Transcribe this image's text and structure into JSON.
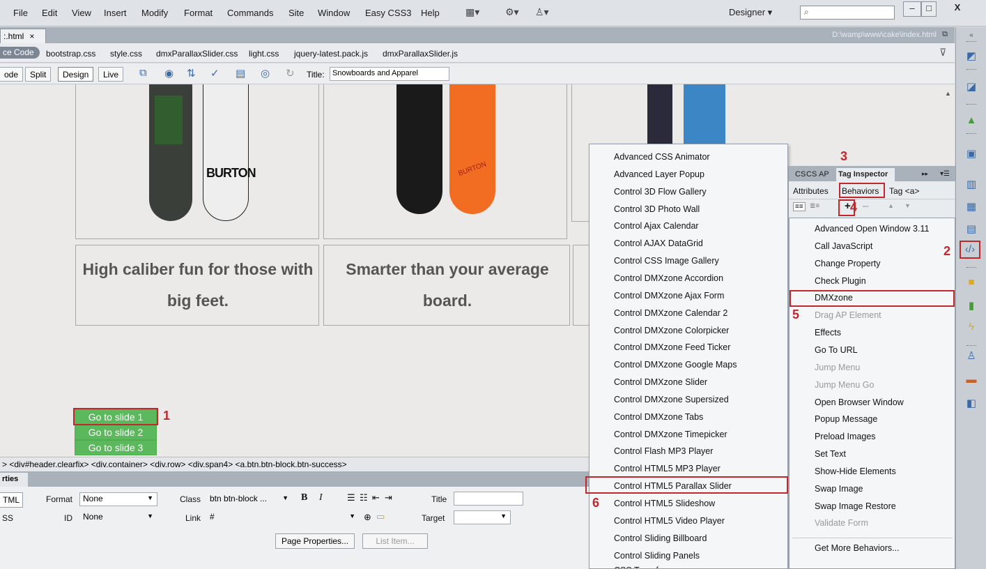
{
  "menubar": {
    "items": [
      "File",
      "Edit",
      "View",
      "Insert",
      "Modify",
      "Format",
      "Commands",
      "Site",
      "Window",
      "Easy CSS3",
      "Help"
    ],
    "workspace": "Designer",
    "workspace_arrow": "▾",
    "window_buttons": [
      "–",
      "□",
      "X"
    ]
  },
  "document": {
    "tab_label": ":.html",
    "tab_close": "×",
    "path": "D:\\wamp\\www\\cake\\index.html",
    "related_files": [
      "ce Code",
      "bootstrap.css",
      "style.css",
      "dmxParallaxSlider.css",
      "light.css",
      "jquery-latest.pack.js",
      "dmxParallaxSlider.js"
    ],
    "view_buttons": [
      "ode",
      "Split",
      "Design",
      "Live"
    ],
    "title_label": "Title:",
    "title_value": "Snowboards and Apparel"
  },
  "canvas": {
    "tagline_1": "High caliber fun for those with big feet.",
    "tagline_2": "Smarter than your average board.",
    "slide_buttons": [
      "Go to slide 1",
      "Go to slide 2",
      "Go to slide 3"
    ],
    "board_text_1": "BURTON",
    "board_text_2": "BURTON"
  },
  "tag_selector": "> <div#header.clearfix> <div.container> <div.row> <div.span4> <a.btn.btn-block.btn-success>",
  "properties": {
    "tab_label": "rties",
    "html_btn": "TML",
    "css_btn": "SS",
    "format_label": "Format",
    "format_value": "None",
    "id_label": "ID",
    "id_value": "None",
    "class_label": "Class",
    "class_value": "btn btn-block ...",
    "link_label": "Link",
    "link_value": "#",
    "title_label": "Title",
    "target_label": "Target",
    "page_properties": "Page Properties...",
    "list_item": "List Item..."
  },
  "submenu": {
    "items": [
      "Advanced CSS Animator",
      "Advanced Layer Popup",
      "Control 3D Flow Gallery",
      "Control 3D Photo Wall",
      "Control Ajax Calendar",
      "Control AJAX DataGrid",
      "Control CSS Image Gallery",
      "Control DMXzone Accordion",
      "Control DMXzone Ajax Form",
      "Control DMXzone Calendar 2",
      "Control DMXzone Colorpicker",
      "Control DMXzone Feed Ticker",
      "Control DMXzone Google Maps",
      "Control DMXzone Slider",
      "Control DMXzone Supersized",
      "Control DMXzone Tabs",
      "Control DMXzone Timepicker",
      "Control Flash MP3 Player",
      "Control HTML5 MP3 Player",
      "Control HTML5 Parallax Slider",
      "Control HTML5 Slideshow",
      "Control HTML5 Video Player",
      "Control Sliding Billboard",
      "Control Sliding Panels"
    ],
    "highlighted": "Control HTML5 Parallax Slider"
  },
  "panel": {
    "tabs": [
      "CS",
      "CS",
      "AP",
      "Tag Inspector"
    ],
    "sub_tabs": [
      "Attributes",
      "Behaviors",
      "Tag <a>"
    ],
    "add_button": "+",
    "remove_button": "–",
    "actions": [
      {
        "label": "Advanced Open Window 3.11",
        "enabled": true
      },
      {
        "label": "Call JavaScript",
        "enabled": true
      },
      {
        "label": "Change Property",
        "enabled": true
      },
      {
        "label": "Check Plugin",
        "enabled": true
      },
      {
        "label": "DMXzone",
        "enabled": true
      },
      {
        "label": "Drag AP Element",
        "enabled": false
      },
      {
        "label": "Effects",
        "enabled": true
      },
      {
        "label": "Go To URL",
        "enabled": true
      },
      {
        "label": "Jump Menu",
        "enabled": false
      },
      {
        "label": "Jump Menu Go",
        "enabled": false
      },
      {
        "label": "Open Browser Window",
        "enabled": true
      },
      {
        "label": "Popup Message",
        "enabled": true
      },
      {
        "label": "Preload Images",
        "enabled": true
      },
      {
        "label": "Set Text",
        "enabled": true
      },
      {
        "label": "Show-Hide Elements",
        "enabled": true
      },
      {
        "label": "Swap Image",
        "enabled": true
      },
      {
        "label": "Swap Image Restore",
        "enabled": true
      },
      {
        "label": "Validate Form",
        "enabled": false
      },
      {
        "label": "Get More Behaviors...",
        "enabled": true
      }
    ]
  },
  "annotations": [
    "1",
    "2",
    "3",
    "4",
    "5",
    "6"
  ],
  "colors": {
    "annotation_red": "#c0282d",
    "success_green": "#5cb85c",
    "chrome_blue_grey": "#a9b1bb"
  }
}
